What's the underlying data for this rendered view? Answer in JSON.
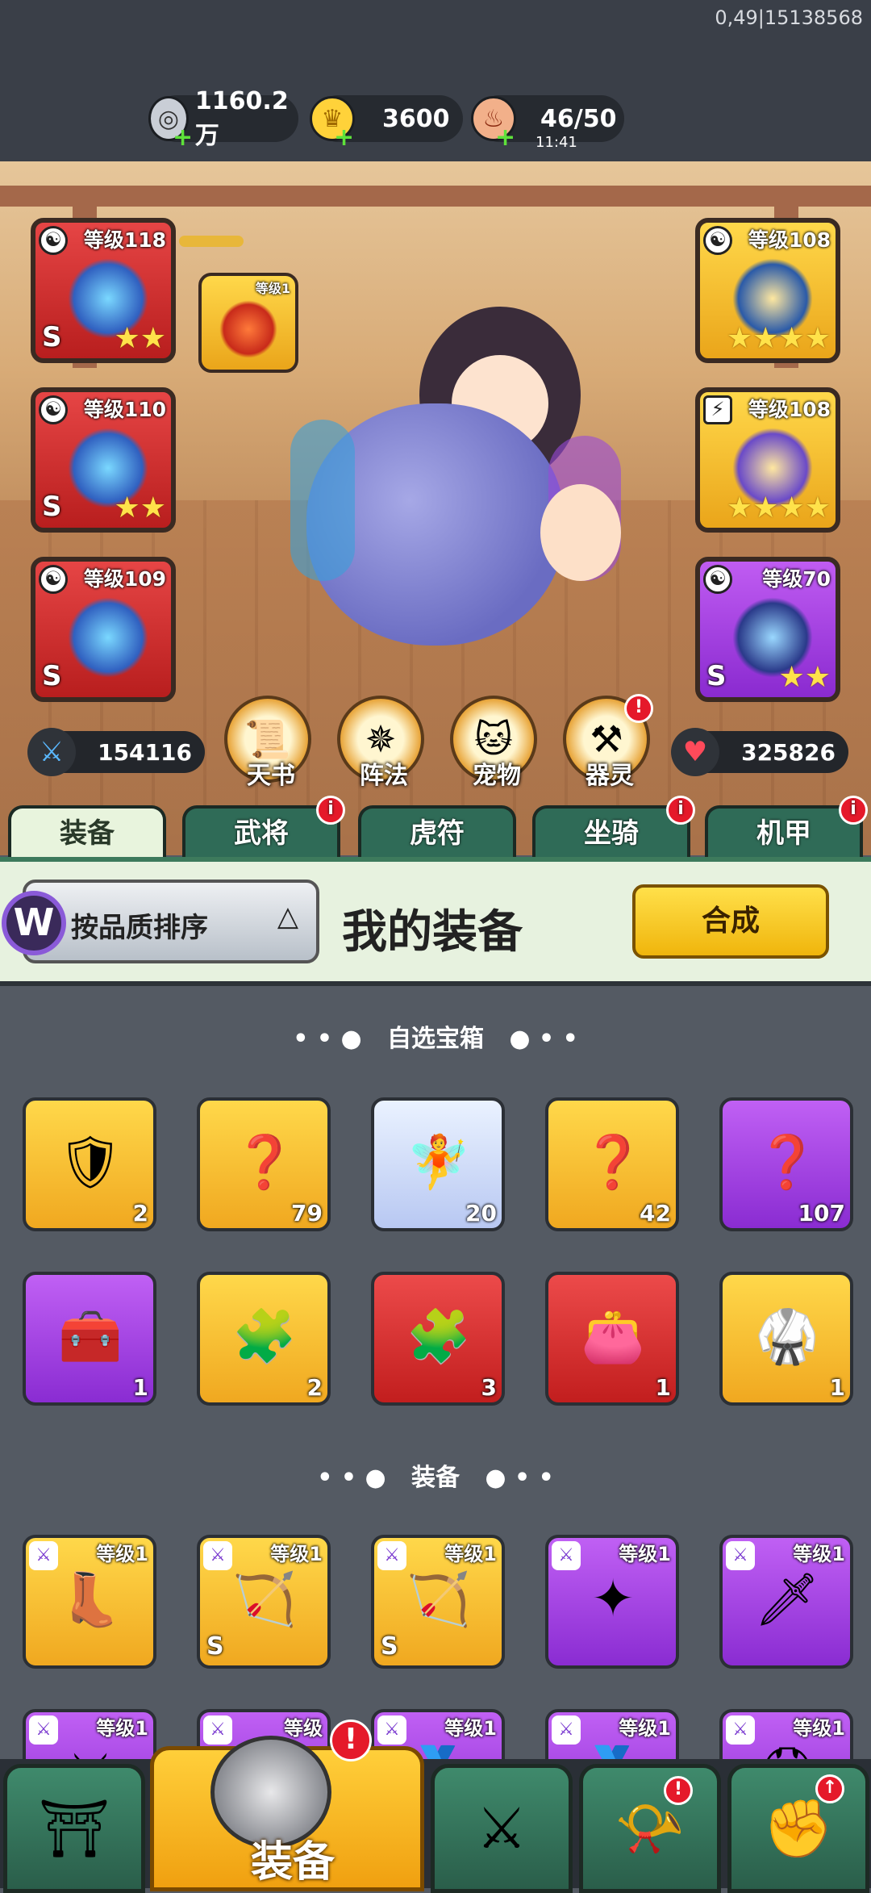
{
  "status": {
    "build": "0,49|15138568"
  },
  "resources": [
    {
      "name": "silver",
      "icon": "silver-coin-icon",
      "value": "1160.2万"
    },
    {
      "name": "gold",
      "icon": "gold-ingot-icon",
      "value": "3600"
    },
    {
      "name": "stamina",
      "icon": "meat-icon",
      "value": "46/50",
      "timer": "11:41"
    }
  ],
  "hero_slots": {
    "left": [
      {
        "level": "等级118",
        "grade": "S",
        "stars": "★★",
        "color": "red"
      },
      {
        "level": "等级110",
        "grade": "S",
        "stars": "★★",
        "color": "red"
      },
      {
        "level": "等级109",
        "grade": "S",
        "stars": "",
        "color": "red"
      }
    ],
    "right": [
      {
        "level": "等级108",
        "grade": "",
        "stars": "★★★★",
        "color": "gold"
      },
      {
        "level": "等级108",
        "grade": "",
        "stars": "★★★★",
        "color": "gold"
      },
      {
        "level": "等级70",
        "grade": "S",
        "stars": "★★",
        "color": "purple"
      }
    ],
    "small": {
      "level": "等级1"
    }
  },
  "stats": {
    "attack": "154116",
    "hp": "325826"
  },
  "features": [
    "天书",
    "阵法",
    "宠物",
    "器灵"
  ],
  "tabs": [
    "装备",
    "武将",
    "虎符",
    "坐骑",
    "机甲"
  ],
  "panel": {
    "sort_label": "按品质排序",
    "title": "我的装备",
    "merge_label": "合成"
  },
  "sections": {
    "chests": "自选宝箱",
    "equipment": "装备"
  },
  "chest_items": [
    {
      "count": "2",
      "color": "gold",
      "icon": "shield-chest-icon"
    },
    {
      "count": "79",
      "color": "gold",
      "icon": "mystery-chest-icon"
    },
    {
      "count": "20",
      "color": "blue",
      "icon": "hero-card-icon"
    },
    {
      "count": "42",
      "color": "gold",
      "icon": "mystery-chest-icon"
    },
    {
      "count": "107",
      "color": "purple",
      "icon": "mystery-chest-icon"
    },
    {
      "count": "1",
      "color": "purple",
      "icon": "treasure-chest-icon"
    },
    {
      "count": "2",
      "color": "gold",
      "icon": "puzzle-chest-icon"
    },
    {
      "count": "3",
      "color": "red",
      "icon": "puzzle-chest-icon"
    },
    {
      "count": "1",
      "color": "red",
      "icon": "pouch-icon"
    },
    {
      "count": "1",
      "color": "gold",
      "icon": "armor-icon"
    }
  ],
  "equipment_items": [
    {
      "level": "等级1",
      "color": "gold",
      "grade": "",
      "icon": "boots-icon"
    },
    {
      "level": "等级1",
      "color": "gold",
      "grade": "S",
      "icon": "crossbow-icon"
    },
    {
      "level": "等级1",
      "color": "gold",
      "grade": "S",
      "icon": "crossbow-icon"
    },
    {
      "level": "等级1",
      "color": "purple",
      "grade": "",
      "icon": "shuriken-icon"
    },
    {
      "level": "等级1",
      "color": "purple",
      "grade": "",
      "icon": "blade-icon"
    },
    {
      "level": "等级1",
      "color": "purple",
      "grade": "",
      "icon": "weapon-icon"
    },
    {
      "level": "等级",
      "color": "purple",
      "grade": "",
      "icon": "weapon-icon"
    },
    {
      "level": "等级1",
      "color": "purple",
      "grade": "",
      "icon": "medal-icon"
    },
    {
      "level": "等级1",
      "color": "purple",
      "grade": "",
      "icon": "medal-icon"
    },
    {
      "level": "等级1",
      "color": "purple",
      "grade": "",
      "icon": "helmet-icon"
    }
  ],
  "nav": [
    {
      "label": "",
      "icon": "gate-icon"
    },
    {
      "label": "装备",
      "icon": "helmet-icon"
    },
    {
      "label": "",
      "icon": "swords-icon"
    },
    {
      "label": "",
      "icon": "horn-icon"
    },
    {
      "label": "",
      "icon": "fist-upgrade-icon"
    }
  ]
}
